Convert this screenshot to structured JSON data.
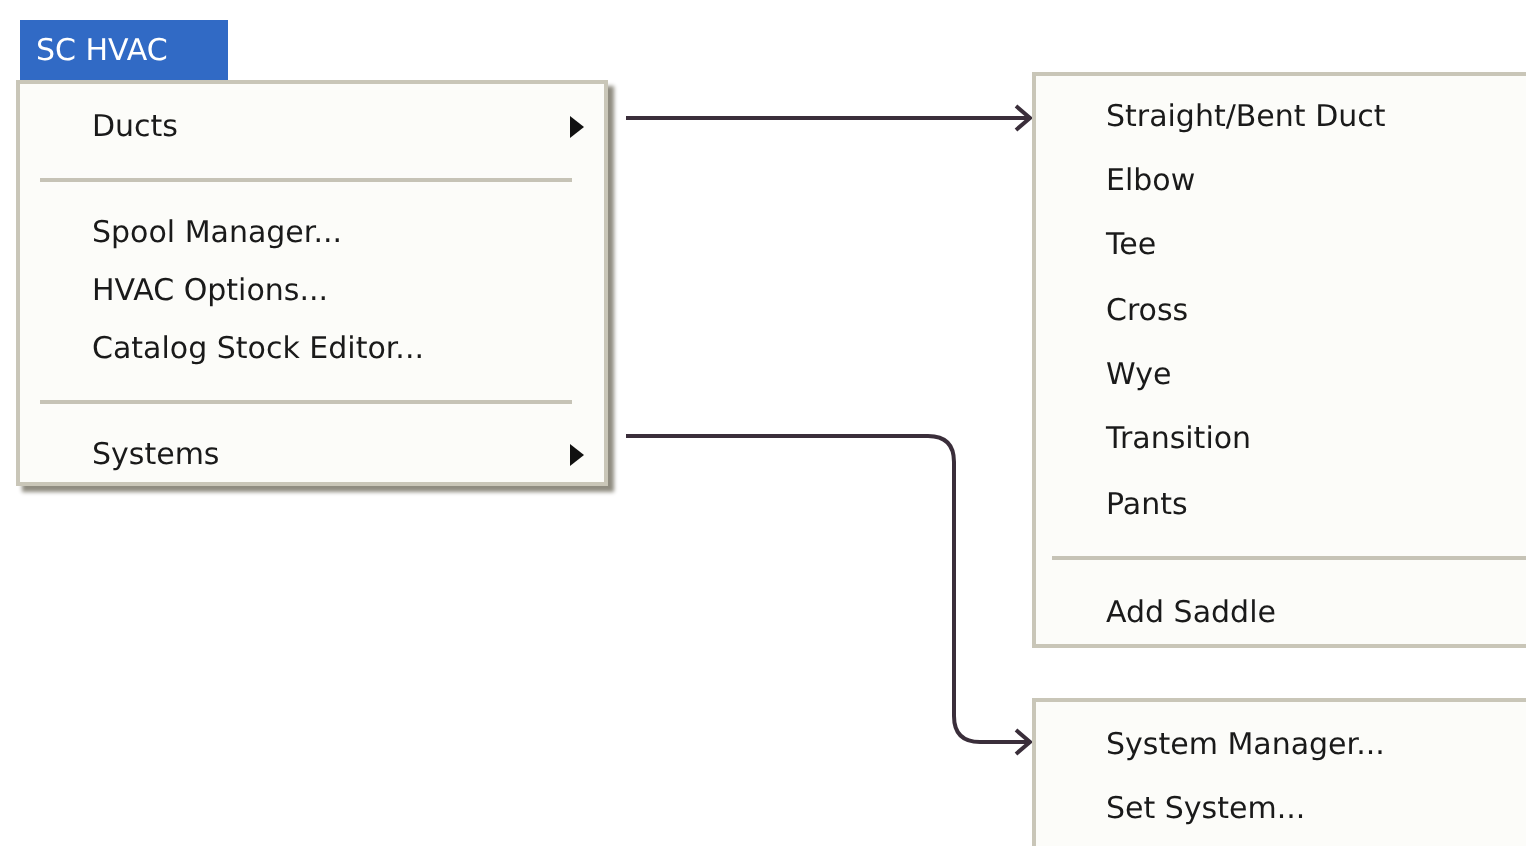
{
  "menu_title": {
    "label": "SC HVAC",
    "selected": true
  },
  "menu": [
    {
      "kind": "submenu",
      "label": "Ducts"
    },
    {
      "kind": "separator"
    },
    {
      "kind": "item",
      "label": "Spool Manager..."
    },
    {
      "kind": "item",
      "label": "HVAC Options..."
    },
    {
      "kind": "item",
      "label": "Catalog Stock Editor..."
    },
    {
      "kind": "separator"
    },
    {
      "kind": "submenu",
      "label": "Systems"
    }
  ],
  "ducts_submenu": [
    {
      "kind": "item",
      "label": "Straight/Bent Duct"
    },
    {
      "kind": "item",
      "label": "Elbow"
    },
    {
      "kind": "item",
      "label": "Tee"
    },
    {
      "kind": "item",
      "label": "Cross"
    },
    {
      "kind": "item",
      "label": "Wye"
    },
    {
      "kind": "item",
      "label": "Transition"
    },
    {
      "kind": "item",
      "label": "Pants"
    },
    {
      "kind": "separator"
    },
    {
      "kind": "item",
      "label": "Add Saddle"
    }
  ],
  "systems_submenu": [
    {
      "kind": "item",
      "label": "System Manager..."
    },
    {
      "kind": "item",
      "label": "Set System..."
    }
  ]
}
